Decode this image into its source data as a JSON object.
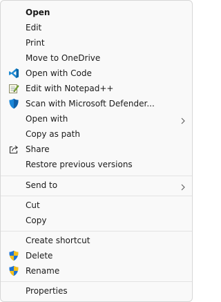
{
  "menu": {
    "items": [
      {
        "label": "Open"
      },
      {
        "label": "Edit"
      },
      {
        "label": "Print"
      },
      {
        "label": "Move to OneDrive"
      },
      {
        "label": "Open with Code",
        "icon": "vscode-icon"
      },
      {
        "label": "Edit with Notepad++",
        "icon": "notepadpp-icon"
      },
      {
        "label": "Scan with Microsoft Defender...",
        "icon": "defender-shield-icon"
      },
      {
        "label": "Open with"
      },
      {
        "label": "Copy as path"
      },
      {
        "label": "Share",
        "icon": "share-icon"
      },
      {
        "label": "Restore previous versions"
      },
      {
        "label": "Send to"
      },
      {
        "label": "Cut"
      },
      {
        "label": "Copy"
      },
      {
        "label": "Create shortcut"
      },
      {
        "label": "Delete",
        "icon": "uac-shield-icon"
      },
      {
        "label": "Rename",
        "icon": "uac-shield-icon"
      },
      {
        "label": "Properties"
      }
    ]
  }
}
